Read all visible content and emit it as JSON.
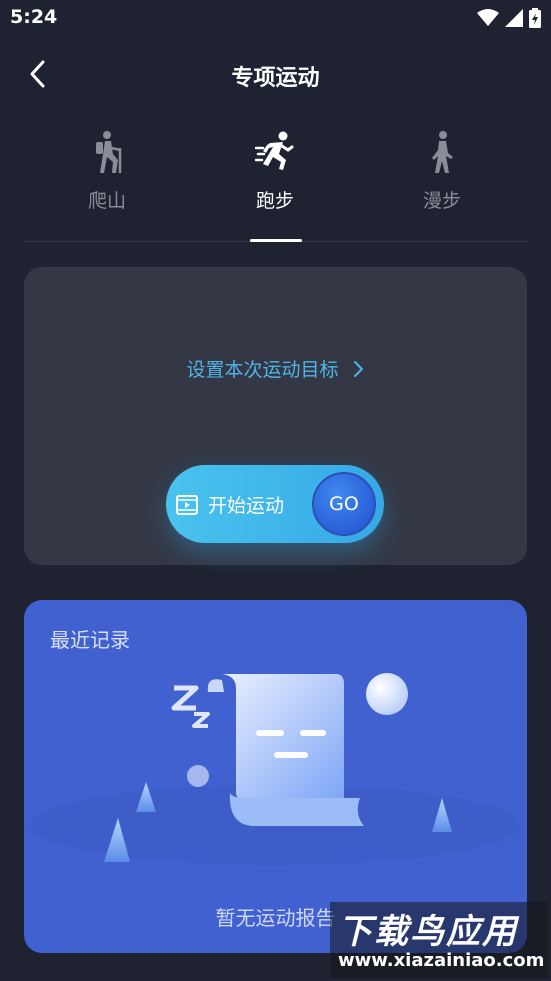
{
  "status_bar": {
    "time": "5:24",
    "icons": [
      "wifi-icon",
      "signal-icon",
      "battery-icon"
    ]
  },
  "header": {
    "back_icon": "chevron-left-icon",
    "title": "专项运动"
  },
  "tabs": [
    {
      "label": "爬山",
      "icon": "hiking-icon",
      "active": false
    },
    {
      "label": "跑步",
      "icon": "running-icon",
      "active": true
    },
    {
      "label": "漫步",
      "icon": "walking-icon",
      "active": false
    }
  ],
  "goal_card": {
    "set_goal_label": "设置本次运动目标",
    "start_label": "开始运动",
    "go_label": "GO"
  },
  "records": {
    "title": "最近记录",
    "empty_text": "暂无运动报告"
  },
  "watermark": {
    "brand": "下载鸟应用",
    "url": "www.xiazainiao.com"
  },
  "colors": {
    "background": "#1f2230",
    "card": "#343845",
    "accent_blue": "#4fb4e8",
    "records_card": "#4161d0"
  }
}
